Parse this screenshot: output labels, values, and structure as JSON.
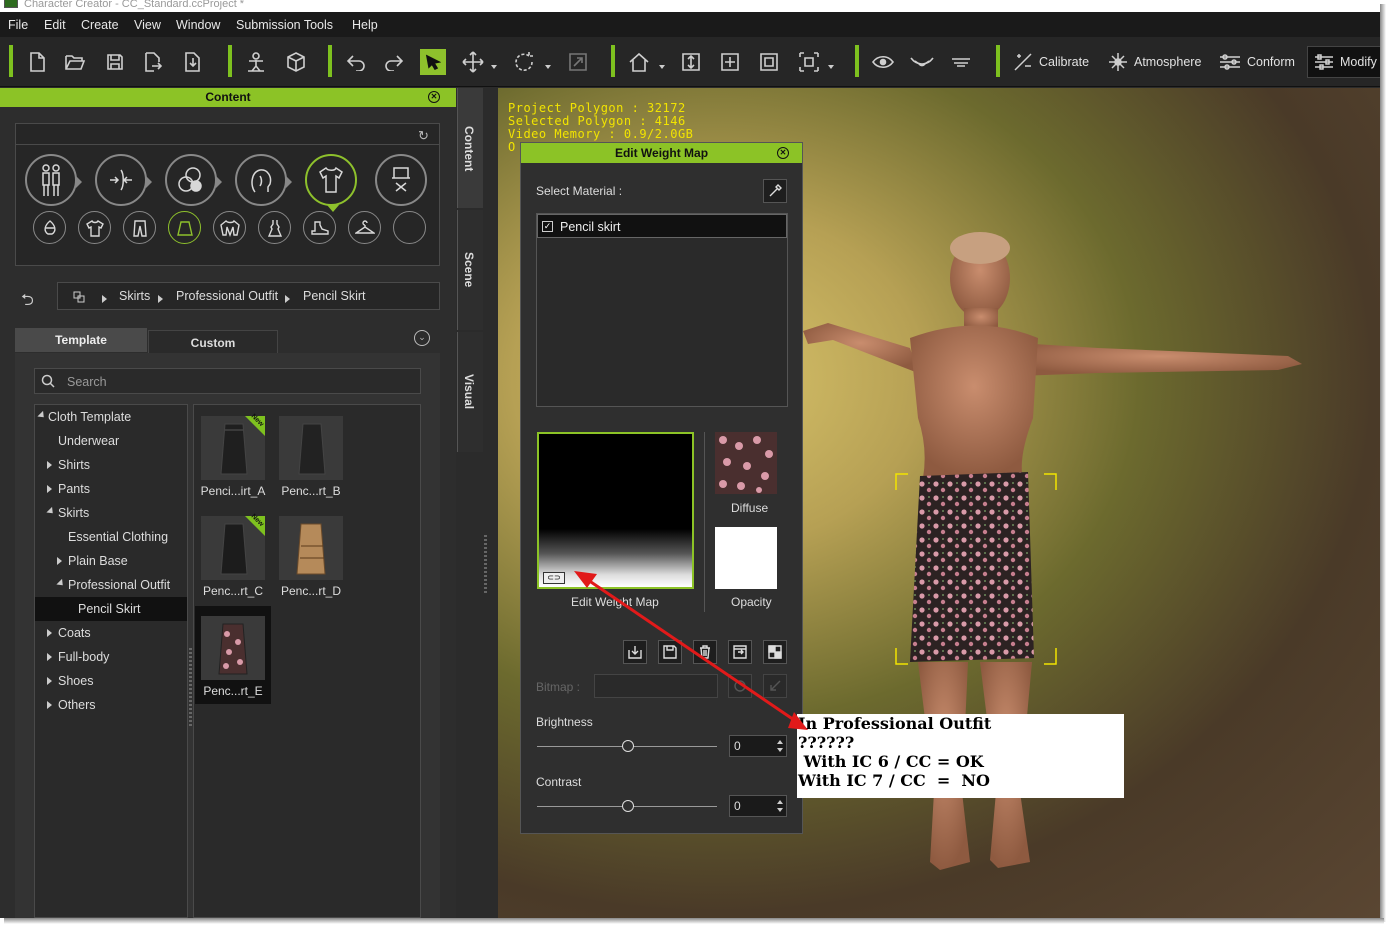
{
  "window": {
    "title": "Character Creator - CC_Standard.ccProject *"
  },
  "menu": [
    "File",
    "Edit",
    "Create",
    "View",
    "Window",
    "Submission Tools",
    "Help"
  ],
  "toolbar": {
    "calibrate": "Calibrate",
    "atmosphere": "Atmosphere",
    "conform": "Conform",
    "modify": "Modify"
  },
  "content_panel": {
    "title": "Content",
    "side_tabs": [
      "Content",
      "Scene",
      "Visual"
    ],
    "breadcrumb": [
      "Skirts",
      "Professional Outfit",
      "Pencil Skirt"
    ],
    "tabs": {
      "template": "Template",
      "custom": "Custom"
    },
    "search_placeholder": "Search",
    "tree": [
      {
        "label": "Cloth Template",
        "state": "expanded"
      },
      {
        "label": "Underwear",
        "state": "leaf"
      },
      {
        "label": "Shirts",
        "state": "collapsed"
      },
      {
        "label": "Pants",
        "state": "collapsed"
      },
      {
        "label": "Skirts",
        "state": "expanded"
      },
      {
        "label": "Essential Clothing",
        "state": "leaf"
      },
      {
        "label": "Plain Base",
        "state": "collapsed"
      },
      {
        "label": "Professional Outfit",
        "state": "expanded"
      },
      {
        "label": "Pencil Skirt",
        "state": "selected"
      },
      {
        "label": "Coats",
        "state": "collapsed"
      },
      {
        "label": "Full-body",
        "state": "collapsed"
      },
      {
        "label": "Shoes",
        "state": "collapsed"
      },
      {
        "label": "Others",
        "state": "collapsed"
      }
    ],
    "thumbnails": [
      {
        "label": "Penci...irt_A",
        "new": "New"
      },
      {
        "label": "Penc...rt_B"
      },
      {
        "label": "Penc...rt_C",
        "new": "New"
      },
      {
        "label": "Penc...rt_D"
      },
      {
        "label": "Penc...rt_E"
      }
    ]
  },
  "hud": {
    "line1": "Project Polygon : 32172",
    "line2": "Selected Polygon : 4146",
    "line3": "Video Memory : 0.9/2.0GB",
    "line4": "O"
  },
  "edit_weight_map": {
    "title": "Edit Weight Map",
    "select_material_label": "Select Material :",
    "material": "Pencil skirt",
    "weight_map_label": "Edit Weight Map",
    "diffuse_label": "Diffuse",
    "opacity_label": "Opacity",
    "bitmap_label": "Bitmap :",
    "brightness_label": "Brightness",
    "brightness_value": "0",
    "contrast_label": "Contrast",
    "contrast_value": "0"
  },
  "note": {
    "line1": "In Professional Outfit",
    "line2": "??????",
    "line3": " With IC 6 / CC = OK",
    "line4": "With IC 7 / CC  =  NO"
  },
  "colors": {
    "accent": "#8cc326",
    "hud": "#f2e400",
    "arrow": "#e11a1a"
  }
}
